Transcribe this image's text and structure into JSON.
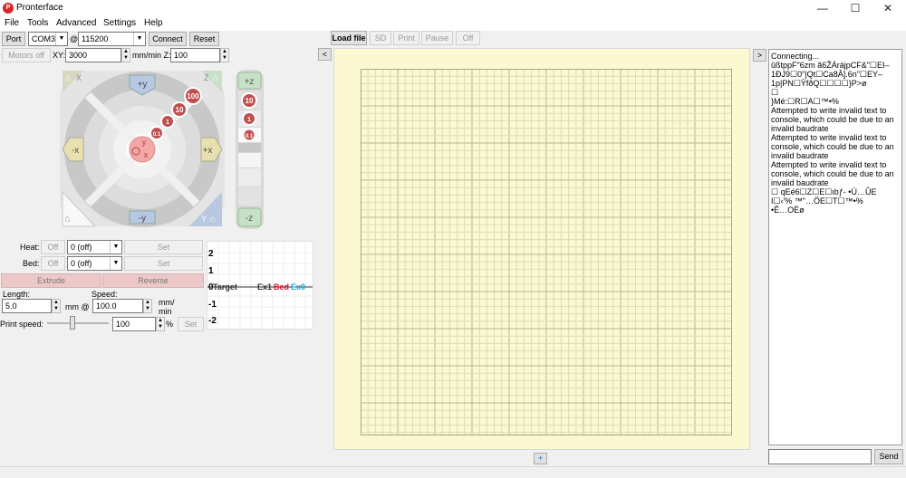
{
  "window": {
    "title": "Pronterface",
    "app_icon_text": "P",
    "controls": {
      "minimize": "—",
      "maximize": "☐",
      "close": "✕"
    }
  },
  "menu": {
    "items": [
      "File",
      "Tools",
      "Advanced",
      "Settings",
      "Help"
    ]
  },
  "connection": {
    "port_label": "Port",
    "port_value": "COM3",
    "at_label": "@",
    "baud_value": "115200",
    "connect_label": "Connect",
    "reset_label": "Reset"
  },
  "motors": {
    "motors_off_label": "Motors off",
    "xy_label": "XY:",
    "xy_value": "3000",
    "unit_label": "mm/min Z:",
    "z_value": "100"
  },
  "file_toolbar": {
    "load_file": "Load file",
    "sd": "SD",
    "print": "Print",
    "pause": "Pause",
    "off": "Off"
  },
  "jog": {
    "home_x": "X",
    "home_z": "Z",
    "home_y": "Y",
    "plus_y": "+y",
    "minus_y": "-y",
    "minus_x": "-x",
    "plus_x": "+x",
    "plus_z": "+z",
    "minus_z": "-z",
    "steps": [
      "100",
      "10",
      "1",
      "0.1"
    ],
    "z_steps": [
      "10",
      "1",
      "0.1"
    ],
    "center_y": "y",
    "center_x": "x"
  },
  "temps": {
    "heat_label": "Heat:",
    "heat_off": "Off",
    "heat_value": "0 (off)",
    "heat_set": "Set",
    "bed_label": "Bed:",
    "bed_off": "Off",
    "bed_value": "0 (off)",
    "bed_set": "Set"
  },
  "extrude": {
    "extrude_label": "Extrude",
    "reverse_label": "Reverse",
    "length_label": "Length:",
    "length_value": "5.0",
    "length_unit": "mm @",
    "speed_label": "Speed:",
    "speed_value": "100.0",
    "speed_unit_1": "mm/",
    "speed_unit_2": "min",
    "print_speed_label": "Print speed:",
    "print_speed_value": "100",
    "print_speed_unit": "%",
    "print_speed_set": "Set",
    "print_speed_level": 0.4
  },
  "temp_graph": {
    "y_ticks": [
      "2",
      "1",
      "0",
      "-1",
      "-2"
    ],
    "legend": [
      {
        "label": "Target",
        "color": "#333333"
      },
      {
        "label": "Ex1",
        "color": "#333333"
      },
      {
        "label": "Bed",
        "color": "#e0102a"
      },
      {
        "label": "Ex0",
        "color": "#18a8e8"
      }
    ]
  },
  "panels": {
    "collapse_left": "<",
    "collapse_right": ">",
    "add_layer": "+"
  },
  "console": {
    "lines": [
      "Connecting...",
      "ûßtppF\"6zm ã6ŽÁrájpCF&\"☐EI–1ÐJ9☐0\"|Qt☐Ca8Â].6n\"☐EY–1p|PN☐ŸfðQ☐☐☐☐}P>ø",
      "☐",
      "}Mé:☐R☐A☐™•%",
      "Attempted to write invalid text to console, which could be due to an invalid baudrate",
      "Attempted to write invalid text to console, which could be due to an invalid baudrate",
      "Attempted to write invalid text to console, which could be due to an invalid baudrate",
      "☐ qEé6☐Z☐E☐ıbƒ- •Ù…ÛE I☐‹'% ™\"…ÖE☐T☐™•%",
      "•Ê…OÈø"
    ],
    "send_label": "Send",
    "input_value": ""
  },
  "colors": {
    "platform_bg": "#fcf8d2",
    "grid_line": "#c8c89a",
    "jog_ring_dark": "#c8c8c8",
    "jog_ring_light": "#e4e4e4",
    "jog_center": "#f4a7a7",
    "step_badge": "#c05050",
    "extrude_button": "#ecc8c8"
  }
}
